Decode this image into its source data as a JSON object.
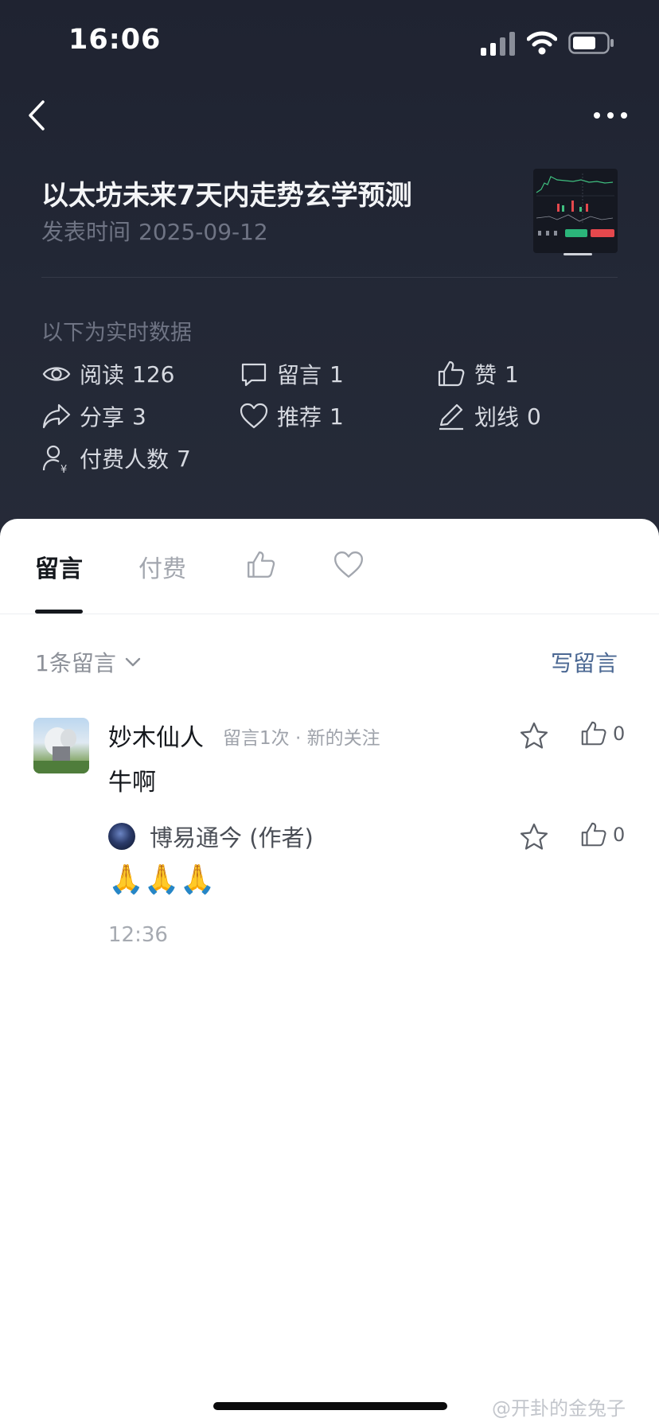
{
  "status_bar": {
    "time": "16:06"
  },
  "colors": {
    "header_bg": "#1f2331",
    "accent": "#4b6893",
    "sheet_bg": "#ffffff"
  },
  "article": {
    "title": "以太坊未来7天内走势玄学预测",
    "publish_label": "发表时间",
    "publish_date": "2025-09-12"
  },
  "realtime": {
    "label": "以下为实时数据",
    "stats": [
      {
        "icon": "eye-icon",
        "label": "阅读",
        "value": "126"
      },
      {
        "icon": "comment-icon",
        "label": "留言",
        "value": "1"
      },
      {
        "icon": "thumbs-up-icon",
        "label": "赞",
        "value": "1"
      },
      {
        "icon": "share-icon",
        "label": "分享",
        "value": "3"
      },
      {
        "icon": "heart-icon",
        "label": "推荐",
        "value": "1"
      },
      {
        "icon": "pen-icon",
        "label": "划线",
        "value": "0"
      },
      {
        "icon": "paid-user-icon",
        "label": "付费人数",
        "value": "7"
      }
    ]
  },
  "tabs": [
    {
      "label": "留言",
      "active": true
    },
    {
      "label": "付费",
      "active": false
    },
    {
      "icon": "thumbs-up-icon"
    },
    {
      "icon": "heart-icon"
    }
  ],
  "comments_header": {
    "count_text": "1条留言",
    "write_label": "写留言"
  },
  "comment": {
    "author": "妙木仙人",
    "meta": "留言1次 · 新的关注",
    "text": "牛啊",
    "likes": "0",
    "reply": {
      "author": "博易通今 (作者)",
      "text": "🙏🙏🙏",
      "likes": "0",
      "time": "12:36"
    }
  },
  "watermark": "@开卦的金兔子"
}
